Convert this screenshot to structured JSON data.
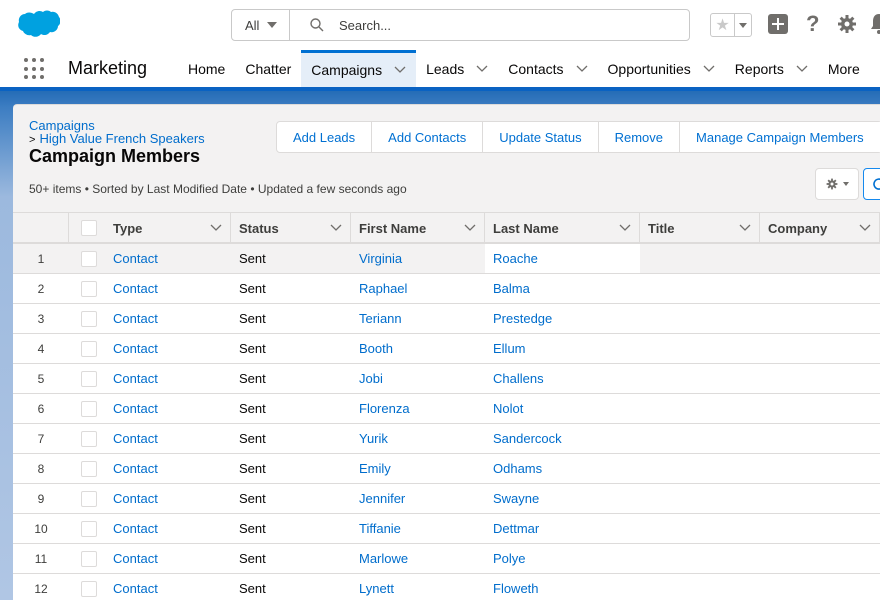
{
  "header": {
    "search_scope": "All",
    "search_placeholder": "Search...",
    "help_glyph": "?"
  },
  "nav": {
    "app_name": "Marketing",
    "tabs": [
      {
        "label": "Home",
        "has_menu": false
      },
      {
        "label": "Chatter",
        "has_menu": false
      },
      {
        "label": "Campaigns",
        "has_menu": true,
        "active": true
      },
      {
        "label": "Leads",
        "has_menu": true
      },
      {
        "label": "Contacts",
        "has_menu": true
      },
      {
        "label": "Opportunities",
        "has_menu": true
      },
      {
        "label": "Reports",
        "has_menu": true
      },
      {
        "label": "More",
        "has_menu": true
      }
    ]
  },
  "page": {
    "breadcrumb_root": "Campaigns",
    "breadcrumb_separator": ">",
    "breadcrumb_record": "High Value French Speakers",
    "title": "Campaign Members",
    "meta": "50+ items • Sorted by Last Modified Date • Updated a few seconds ago",
    "actions": [
      "Add Leads",
      "Add Contacts",
      "Update Status",
      "Remove",
      "Manage Campaign Members"
    ]
  },
  "table": {
    "columns": [
      "Type",
      "Status",
      "First Name",
      "Last Name",
      "Title",
      "Company"
    ],
    "rows": [
      {
        "n": "1",
        "type": "Contact",
        "status": "Sent",
        "first": "Virginia",
        "last": "Roache",
        "title": "",
        "company": ""
      },
      {
        "n": "2",
        "type": "Contact",
        "status": "Sent",
        "first": "Raphael",
        "last": "Balma",
        "title": "",
        "company": ""
      },
      {
        "n": "3",
        "type": "Contact",
        "status": "Sent",
        "first": "Teriann",
        "last": "Prestedge",
        "title": "",
        "company": ""
      },
      {
        "n": "4",
        "type": "Contact",
        "status": "Sent",
        "first": "Booth",
        "last": "Ellum",
        "title": "",
        "company": ""
      },
      {
        "n": "5",
        "type": "Contact",
        "status": "Sent",
        "first": "Jobi",
        "last": "Challens",
        "title": "",
        "company": ""
      },
      {
        "n": "6",
        "type": "Contact",
        "status": "Sent",
        "first": "Florenza",
        "last": "Nolot",
        "title": "",
        "company": ""
      },
      {
        "n": "7",
        "type": "Contact",
        "status": "Sent",
        "first": "Yurik",
        "last": "Sandercock",
        "title": "",
        "company": ""
      },
      {
        "n": "8",
        "type": "Contact",
        "status": "Sent",
        "first": "Emily",
        "last": "Odhams",
        "title": "",
        "company": ""
      },
      {
        "n": "9",
        "type": "Contact",
        "status": "Sent",
        "first": "Jennifer",
        "last": "Swayne",
        "title": "",
        "company": ""
      },
      {
        "n": "10",
        "type": "Contact",
        "status": "Sent",
        "first": "Tiffanie",
        "last": "Dettmar",
        "title": "",
        "company": ""
      },
      {
        "n": "11",
        "type": "Contact",
        "status": "Sent",
        "first": "Marlowe",
        "last": "Polye",
        "title": "",
        "company": ""
      },
      {
        "n": "12",
        "type": "Contact",
        "status": "Sent",
        "first": "Lynett",
        "last": "Floweth",
        "title": "",
        "company": ""
      }
    ]
  },
  "colors": {
    "brand_blue": "#00a1e0",
    "link": "#006dcc",
    "active_tab_bar": "#0070d2"
  }
}
